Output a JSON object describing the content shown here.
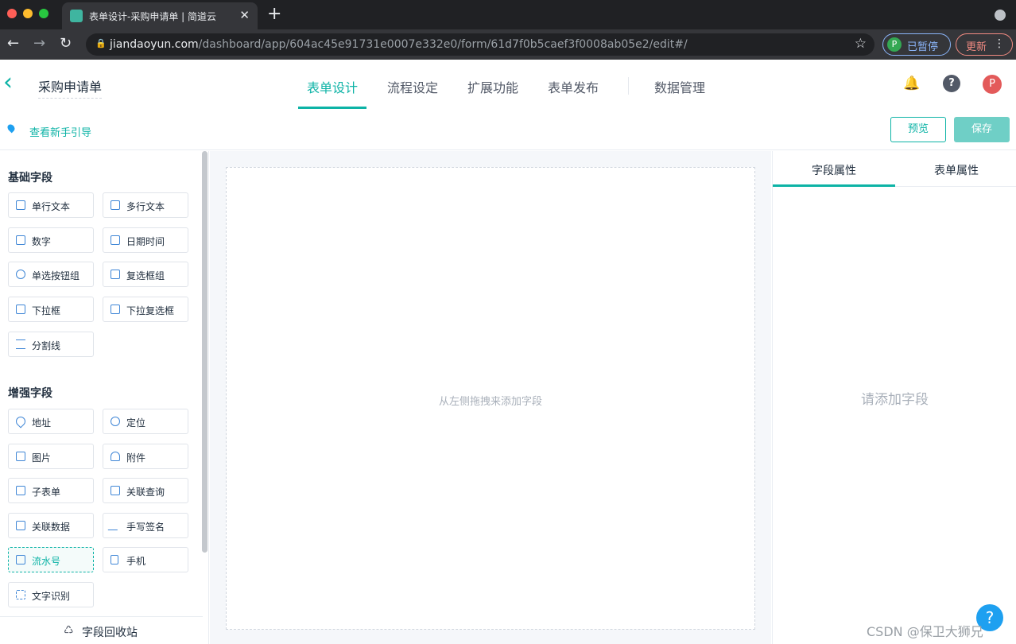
{
  "browser": {
    "tab_title": "表单设计-采购申请单 | 简道云",
    "tab_close": "✕",
    "new_tab": "+",
    "url_host": "jiandaoyun.com",
    "url_path": "/dashboard/app/604ac45e91731e0007e332e0/form/61d7f0b5caef3f0008ab05e2/edit#/",
    "profile_initial": "P",
    "profile_status": "已暂停",
    "update_label": "更新",
    "colors": {
      "close": "#ff5f57",
      "minimize": "#febc2e",
      "maximize": "#28c840"
    }
  },
  "header": {
    "form_name": "采购申请单",
    "tabs": [
      {
        "label": "表单设计"
      },
      {
        "label": "流程设定"
      },
      {
        "label": "扩展功能"
      },
      {
        "label": "表单发布"
      },
      {
        "label": "数据管理"
      }
    ],
    "avatar_initial": "P",
    "help_glyph": "?",
    "accent": "#0db3a6"
  },
  "subbar": {
    "guide": "查看新手引导",
    "preview": "预览",
    "save": "保存"
  },
  "left": {
    "basic_title": "基础字段",
    "basic": [
      {
        "label": "单行文本",
        "icon": "text-line-icon"
      },
      {
        "label": "多行文本",
        "icon": "text-area-icon"
      },
      {
        "label": "数字",
        "icon": "number-icon"
      },
      {
        "label": "日期时间",
        "icon": "calendar-icon"
      },
      {
        "label": "单选按钮组",
        "icon": "radio-icon"
      },
      {
        "label": "复选框组",
        "icon": "checkbox-icon"
      },
      {
        "label": "下拉框",
        "icon": "dropdown-icon"
      },
      {
        "label": "下拉复选框",
        "icon": "multi-dropdown-icon"
      },
      {
        "label": "分割线",
        "icon": "divider-icon"
      }
    ],
    "advanced_title": "增强字段",
    "advanced": [
      {
        "label": "地址",
        "icon": "location-pin-icon"
      },
      {
        "label": "定位",
        "icon": "crosshair-icon"
      },
      {
        "label": "图片",
        "icon": "image-icon"
      },
      {
        "label": "附件",
        "icon": "cloud-upload-icon"
      },
      {
        "label": "子表单",
        "icon": "subform-icon"
      },
      {
        "label": "关联查询",
        "icon": "link-query-icon"
      },
      {
        "label": "关联数据",
        "icon": "link-data-icon"
      },
      {
        "label": "手写签名",
        "icon": "pen-icon"
      },
      {
        "label": "流水号",
        "icon": "serial-number-icon"
      },
      {
        "label": "手机",
        "icon": "phone-icon"
      },
      {
        "label": "文字识别",
        "icon": "ocr-icon"
      }
    ],
    "recycle": "字段回收站"
  },
  "canvas": {
    "hint": "从左侧拖拽来添加字段"
  },
  "right": {
    "tabs": [
      {
        "label": "字段属性"
      },
      {
        "label": "表单属性"
      }
    ],
    "hint": "请添加字段"
  },
  "watermark": "CSDN @保卫大狮兄"
}
